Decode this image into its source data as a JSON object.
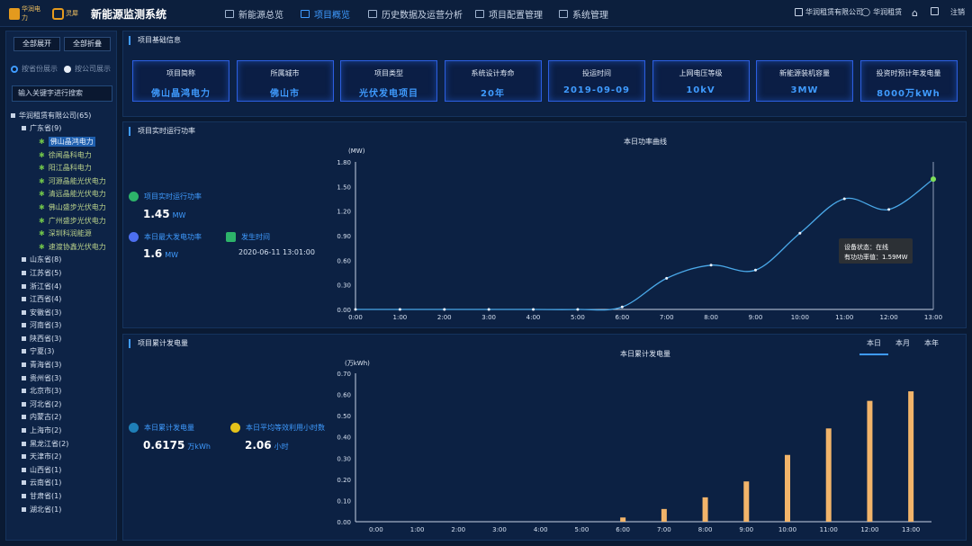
{
  "header": {
    "logo1_text": "华润电力",
    "logo2_text": "灵犀",
    "app_title": "新能源监测系统",
    "nav": [
      "新能源总览",
      "项目概览",
      "历史数据及运营分析",
      "项目配置管理",
      "系统管理"
    ],
    "active_nav": 1,
    "company": "华润租赁有限公司",
    "user": "华润租赁",
    "logout": "注销"
  },
  "sidebar": {
    "expand_all": "全部展开",
    "collapse_all": "全部折叠",
    "radio_province": "按省份展示",
    "radio_company": "按公司展示",
    "search_placeholder": "输入关键字进行搜索",
    "root": "华润租赁有限公司(65)",
    "expanded_province": "广东省(9)",
    "projects": [
      "佛山晶鸿电力",
      "徐闻晶科电力",
      "阳江晶科电力",
      "河源晶能光伏电力",
      "清远晶能光伏电力",
      "佛山盛步光伏电力",
      "广州盛步光伏电力",
      "深圳科润能源",
      "速渡协鑫光伏电力"
    ],
    "selected_project": 0,
    "provinces": [
      "山东省(8)",
      "江苏省(5)",
      "浙江省(4)",
      "江西省(4)",
      "安徽省(3)",
      "河南省(3)",
      "陕西省(3)",
      "宁夏(3)",
      "青海省(3)",
      "贵州省(3)",
      "北京市(3)",
      "河北省(2)",
      "内蒙古(2)",
      "上海市(2)",
      "黑龙江省(2)",
      "天津市(2)",
      "山西省(1)",
      "云南省(1)",
      "甘肃省(1)",
      "湖北省(1)"
    ]
  },
  "basic_info": {
    "title": "项目基础信息",
    "cards": [
      {
        "k": "项目简称",
        "v": "佛山晶鸿电力"
      },
      {
        "k": "所属城市",
        "v": "佛山市"
      },
      {
        "k": "项目类型",
        "v": "光伏发电项目"
      },
      {
        "k": "系统设计寿命",
        "v": "20年"
      },
      {
        "k": "投运时间",
        "v": "2019-09-09"
      },
      {
        "k": "上网电压等级",
        "v": "10kV"
      },
      {
        "k": "新能源装机容量",
        "v": "3MW"
      },
      {
        "k": "投资时预计年发电量",
        "v": "8000万kWh"
      }
    ]
  },
  "power": {
    "title": "项目实时运行功率",
    "realtime_label": "项目实时运行功率",
    "realtime_value": "1.45",
    "realtime_unit": "MW",
    "max_label": "本日最大发电功率",
    "max_value": "1.6",
    "max_unit": "MW",
    "time_label": "发生时间",
    "time_value": "2020-06-11 13:01:00",
    "tooltip_status": "设备状态：在线",
    "tooltip_value": "有功功率值：1.59MW"
  },
  "energy": {
    "title": "项目累计发电量",
    "tabs": [
      "本日",
      "本月",
      "本年"
    ],
    "active_tab": 0,
    "daily_label": "本日累计发电量",
    "daily_value": "0.6175",
    "daily_unit": "万kWh",
    "hours_label": "本日平均等效利用小时数",
    "hours_value": "2.06",
    "hours_unit": "小时"
  },
  "colors": {
    "accent": "#3f9bff",
    "line": "#4aa8e8",
    "bar": "#f2b46a",
    "point": "#7ee05a"
  },
  "chart_data": [
    {
      "type": "line",
      "title": "本日功率曲线",
      "ylabel": "(MW)",
      "x": [
        "0:00",
        "1:00",
        "2:00",
        "3:00",
        "4:00",
        "5:00",
        "6:00",
        "7:00",
        "8:00",
        "9:00",
        "10:00",
        "11:00",
        "12:00",
        "13:00"
      ],
      "values": [
        0,
        0,
        0,
        0,
        0,
        0,
        0.03,
        0.38,
        0.54,
        0.48,
        0.93,
        1.35,
        1.22,
        1.59
      ],
      "ylim": [
        0,
        1.8
      ],
      "yticks": [
        "0.00",
        "0.30",
        "0.60",
        "0.90",
        "1.20",
        "1.50",
        "1.80"
      ],
      "grid": false
    },
    {
      "type": "bar",
      "title": "本日累计发电量",
      "ylabel": "(万kWh)",
      "categories": [
        "0:00",
        "1:00",
        "2:00",
        "3:00",
        "4:00",
        "5:00",
        "6:00",
        "7:00",
        "8:00",
        "9:00",
        "10:00",
        "11:00",
        "12:00",
        "13:00"
      ],
      "values": [
        0,
        0,
        0,
        0,
        0,
        0,
        0.02,
        0.06,
        0.115,
        0.19,
        0.315,
        0.44,
        0.57,
        0.615
      ],
      "ylim": [
        0,
        0.7
      ],
      "yticks": [
        "0.00",
        "0.10",
        "0.20",
        "0.30",
        "0.40",
        "0.50",
        "0.60",
        "0.70"
      ],
      "grid": false
    }
  ]
}
